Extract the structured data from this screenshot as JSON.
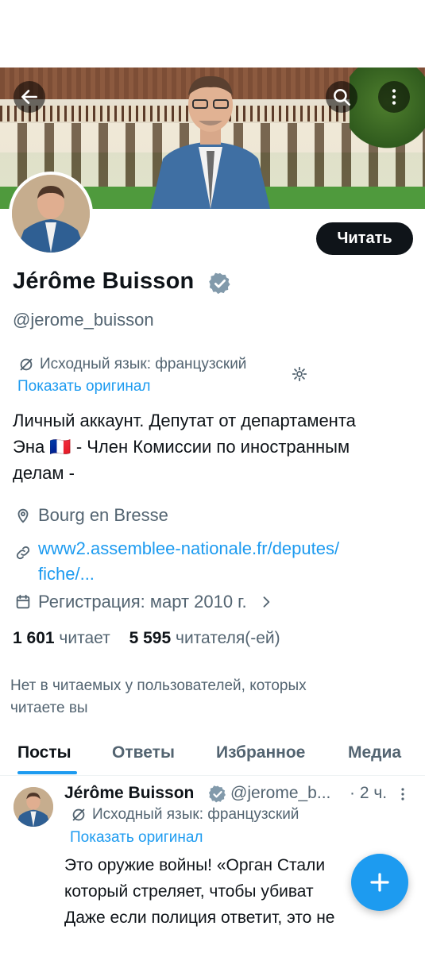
{
  "header": {
    "back_icon": "arrow-left-icon",
    "search_icon": "search-icon",
    "more_icon": "more-vertical-icon"
  },
  "profile": {
    "name": "Jérôme Buisson",
    "handle": "@jerome_buisson",
    "follow_label": "Читать",
    "translation_note": "Исходный язык: французский",
    "show_original": "Показать оригинал",
    "bio_line1": "Личный аккаунт. Депутат от департамента",
    "bio_line2": "Эна 🇫🇷 - Член Комиссии по иностранным",
    "bio_line3": "делам -",
    "location": "Bourg en Bresse",
    "website_line1": "www2.assemblee-nationale.fr/deputes/",
    "website_line2": "fiche/...",
    "joined": "Регистрация: март 2010 г.",
    "following_count": "1 601",
    "following_label": "читает",
    "followers_count": "5 595",
    "followers_label": "читателя(-ей)",
    "no_mutual_line1": "Нет в читаемых у пользователей, которых",
    "no_mutual_line2": "читаете вы"
  },
  "tabs": [
    {
      "label": "Посты",
      "active": true
    },
    {
      "label": "Ответы",
      "active": false
    },
    {
      "label": "Избранное",
      "active": false
    },
    {
      "label": "Медиа",
      "active": false
    }
  ],
  "tweet": {
    "name": "Jérôme Buisson",
    "handle": "@jerome_b...",
    "time": "· 2 ч.",
    "translation_note": "Исходный язык: французский",
    "show_original": "Показать оригинал",
    "text_line1": "Это оружие войны! «Орган Стали",
    "text_line2": "который стреляет, чтобы убиват",
    "text_line3": "Даже если полиция ответит, это не"
  },
  "colors": {
    "accent": "#1d9bf0",
    "text": "#0f1419",
    "secondary": "#536471",
    "verified": "#829aab"
  }
}
